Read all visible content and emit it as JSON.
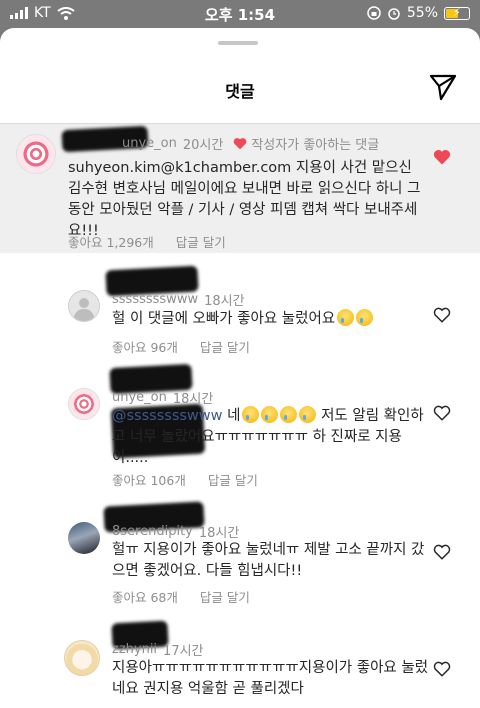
{
  "status_bar": {
    "carrier": "KT",
    "time": "오후 1:54",
    "battery": "55%",
    "battery_level": 0.55,
    "battery_color": "#f5c518"
  },
  "header": {
    "title": "댓글"
  },
  "pinned_comment": {
    "username_visible": "unye_on",
    "time": "20시간",
    "liked_by_author": "작성자가 좋아하는 댓글",
    "text": "suhyeon.kim@k1chamber.com 지용이 사건 맡으신 김수현 변호사님 메일이에요 보내면 바로 읽으신다 하니 그동안 모아뒀던 악플 / 기사 / 영상 피뎀 캡쳐 싹다 보내주세요!!!",
    "likes": "좋아요 1,296개",
    "reply": "답글 달기",
    "liked": true,
    "heart_color": "#ed4956"
  },
  "replies": [
    {
      "username_visible": "sssssssswww",
      "time": "18시간",
      "text": "헐 이 댓글에 오빠가 좋아요 눌렀어요",
      "emoji_count": 2,
      "likes": "좋아요 96개",
      "reply": "답글 달기",
      "avatar": "default-avatar"
    },
    {
      "username_visible": "unye_on",
      "time": "18시간",
      "mention": "@sssssssswww",
      "text_a": "네",
      "text_b": "저도 알림 확인하고 너무 놀랐어요ㅠㅠㅠㅠㅠㅠㅠ 하 진짜로 지용이.....",
      "emoji_count": 4,
      "likes": "좋아요 106개",
      "reply": "답글 달기",
      "avatar": "swirl-avatar"
    },
    {
      "username_visible": "8serendipity",
      "time": "18시간",
      "text": "헐ㅠ 지용이가 좋아요 눌렀네ㅠ 제발 고소 끝까지 갔으면 좋겠어요. 다들 힘냅시다!!",
      "likes": "좋아요 68개",
      "reply": "답글 달기",
      "avatar": "photo-avatar"
    },
    {
      "username_visible": "zzhynii",
      "time": "17시간",
      "text": "지용아ㅠㅠㅠㅠㅠㅠㅠㅠㅠㅠㅠ지용이가 좋아요 눌렀네요 권지용 억울함 곧 풀리겠다",
      "likes": "",
      "reply": "",
      "avatar": "anime-avatar"
    }
  ]
}
